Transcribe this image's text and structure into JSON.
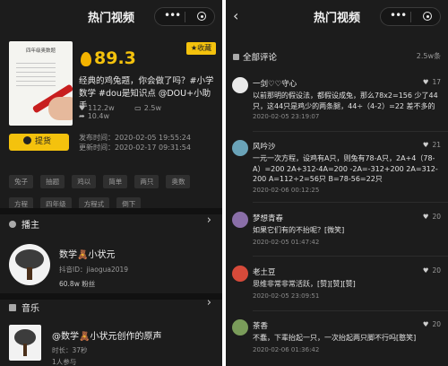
{
  "left_panel": {
    "header": {
      "title": "热门视频",
      "menu_dots": "•••"
    },
    "video": {
      "cover_title": "四年级奥数题",
      "score": "89.3",
      "collect_label": "收藏",
      "description": "经典的鸡兔题，你会做了吗？#小学数学 #dou是知识点 @DOU+小助手",
      "likes": "112.2w",
      "comments": "2.5w",
      "shares": "10.4w",
      "promo_label": "提货",
      "publish_time": "发布时间：2020-02-05 19:55:24",
      "update_time": "更新时间：2020-02-17 09:31:54",
      "tags": [
        "兔子",
        "抽题",
        "鸡以",
        "简单",
        "两只",
        "奥数",
        "方程",
        "四年级",
        "方程式",
        "倒下"
      ]
    },
    "author_section": {
      "title": "播主",
      "name": "数学🧸小状元",
      "douyin_id": "抖音ID：jiaogua2019",
      "fans": "60.8w 粉丝"
    },
    "music_section": {
      "title": "音乐",
      "name": "@数学🧸小状元创作的原声",
      "duration": "时长：37秒",
      "users": "1人参与"
    }
  },
  "right_panel": {
    "header": {
      "title": "热门视频",
      "menu_dots": "•••",
      "back": "‹"
    },
    "comments_title": "全部评论",
    "comments_count": "2.5w条",
    "comments": [
      {
        "name": "一剑♡♡守心",
        "likes": "17",
        "text": "以前那明的假设法，都假设成兔，那么78x2=156 少了44只，这44只是鸡少的两条腿，44÷（4-2）=22 差不多的",
        "date": "2020-02-05 23:19:07",
        "avatar_color": "#e9e9e9"
      },
      {
        "name": "风吟沙",
        "likes": "21",
        "text": "一元一次方程，设鸡有A只，则兔有78-A只，2A+4（78-A）=200 2A+312-4A=200 -2A=-312+200 2A=312-200 A=112÷2=56只 B=78-56=22只",
        "date": "2020-02-06 00:12:25",
        "avatar_color": "#6aa3b8"
      },
      {
        "name": "梦想青春",
        "likes": "20",
        "text": "如果它们有的不抬呢？[微笑]",
        "date": "2020-02-05 01:47:42",
        "avatar_color": "#8a6fa8"
      },
      {
        "name": "老土豆",
        "likes": "20",
        "text": "思维非常非常活跃，[赞][赞][赞]",
        "date": "2020-02-05 23:09:51",
        "avatar_color": "#d64a3a"
      },
      {
        "name": "茶香",
        "likes": "20",
        "text": "不蠢，下辈抬起一只，一次抬起两只脚不行吗[憨笑]",
        "date": "2020-02-06 01:36:42",
        "avatar_color": "#7a9c5a"
      }
    ]
  }
}
